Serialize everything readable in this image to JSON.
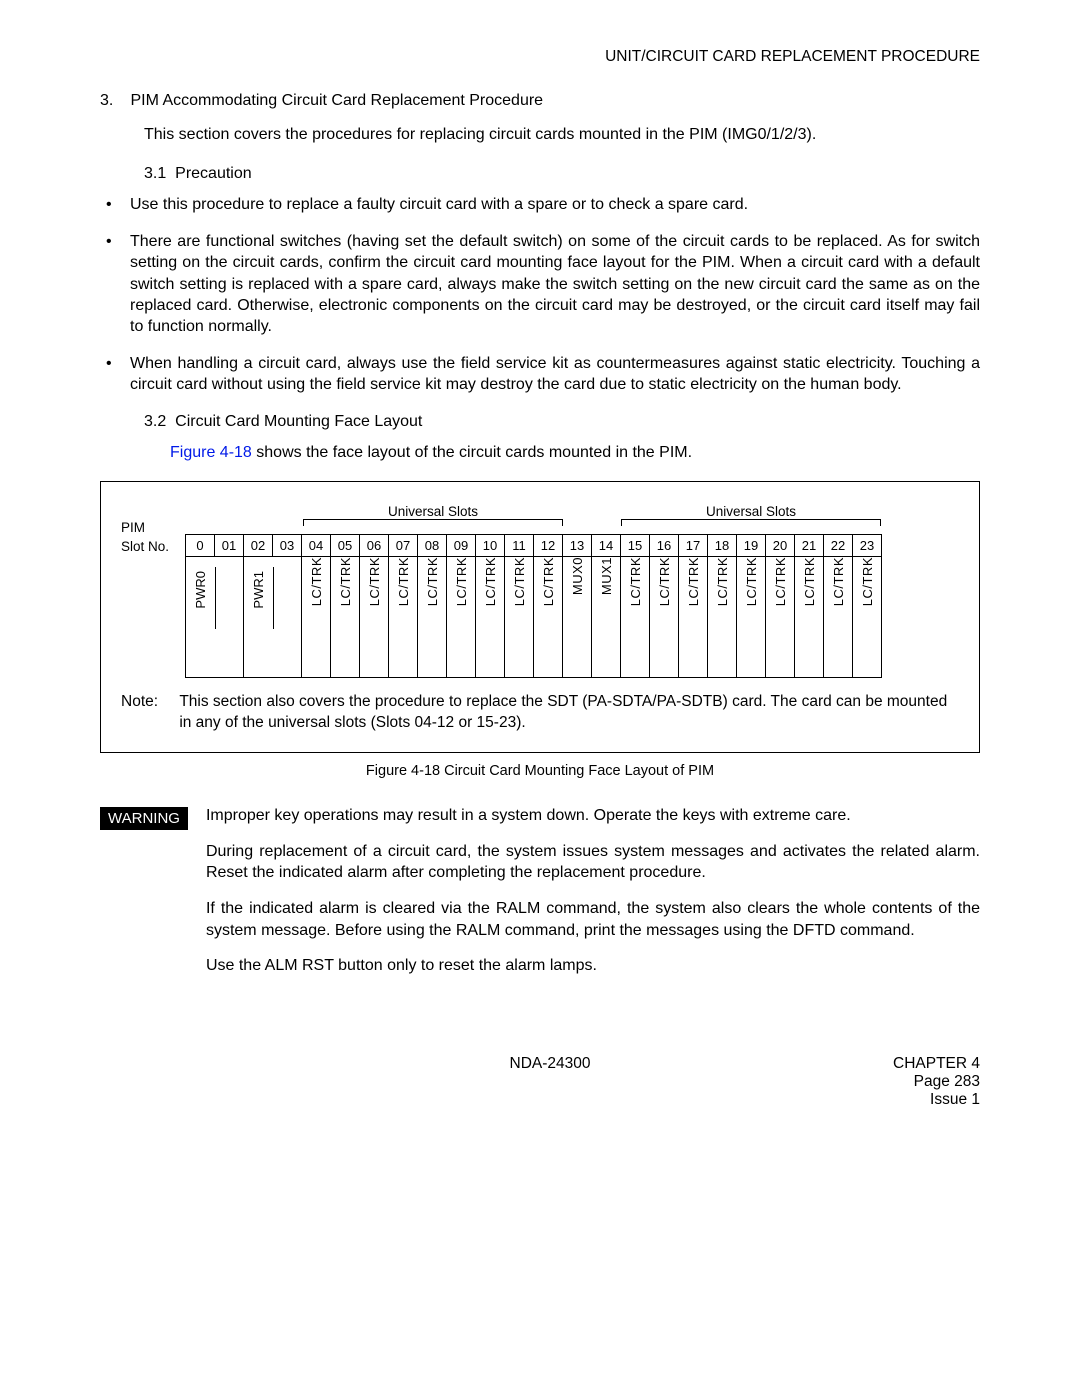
{
  "header": {
    "title": "UNIT/CIRCUIT CARD REPLACEMENT PROCEDURE"
  },
  "section3": {
    "num": "3.",
    "title": "PIM Accommodating Circuit Card Replacement Procedure",
    "intro": "This section covers the procedures for replacing circuit cards mounted in the PIM (IMG0/1/2/3).",
    "s31_num": "3.1",
    "s31_title": "Precaution",
    "bullets": [
      "Use this procedure to replace a faulty circuit card with a spare or to check a spare card.",
      "There are functional switches (having set the default switch) on some of the circuit cards to be replaced. As for switch setting on the circuit cards, confirm the circuit card mounting face layout for the PIM. When a circuit card with a default switch setting is replaced with a spare card, always make the switch setting on the new circuit card the same as on the replaced card. Otherwise, electronic components on the circuit card may be destroyed, or the circuit card itself may fail to function normally.",
      "When handling a circuit card, always use the field service kit as countermeasures against static electricity. Touching a circuit card without using the field service kit may destroy the card due to static electricity on the human body."
    ],
    "s32_num": "3.2",
    "s32_title": "Circuit Card Mounting Face Layout",
    "figref": "Figure 4-18 ",
    "figref_tail": "shows the face layout of the circuit cards mounted in the PIM."
  },
  "diagram": {
    "pim": "PIM",
    "slotno": "Slot No.",
    "universal": "Universal Slots",
    "slot_nums": [
      "0",
      "01",
      "02",
      "03",
      "04",
      "05",
      "06",
      "07",
      "08",
      "09",
      "10",
      "11",
      "12",
      "13",
      "14",
      "15",
      "16",
      "17",
      "18",
      "19",
      "20",
      "21",
      "22",
      "23"
    ],
    "cards": {
      "pwr0": "PWR0",
      "pwr1": "PWR1",
      "lctrk": "LC/TRK",
      "mux0": "MUX0",
      "mux1": "MUX1"
    },
    "note_label": "Note:",
    "note_text": "This section also covers the procedure to replace the SDT (PA-SDTA/PA-SDTB) card. The card can be mounted in any of the universal slots (Slots 04-12 or 15-23).",
    "caption": "Figure 4-18   Circuit Card Mounting Face Layout of PIM"
  },
  "warning": {
    "badge": "WARNING",
    "p1": "Improper key operations may result in a system down. Operate the keys with extreme care.",
    "p2": "During replacement of a circuit card, the system issues system messages and activates the related alarm. Reset the indicated alarm after completing the replacement procedure.",
    "p3": "If the indicated alarm is cleared via the RALM command, the system also clears the whole contents of the system message. Before using the RALM command, print the messages using the DFTD command.",
    "p4": "Use the ALM RST button only to reset the alarm lamps."
  },
  "footer": {
    "center": "NDA-24300",
    "chapter": "CHAPTER 4",
    "page": "Page 283",
    "issue": "Issue 1"
  }
}
